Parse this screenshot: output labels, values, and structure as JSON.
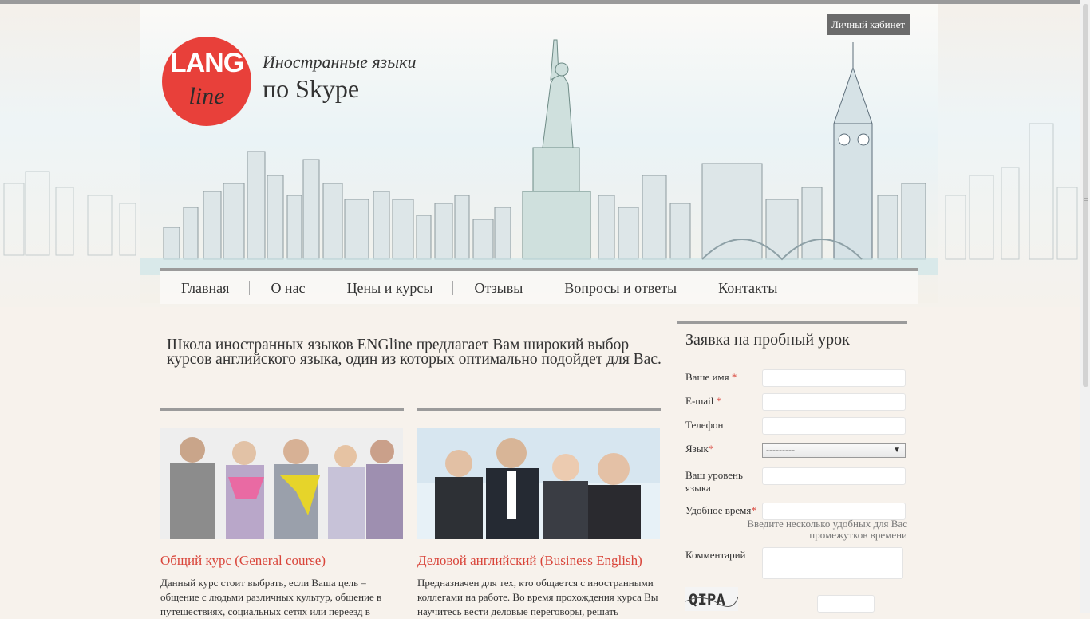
{
  "header": {
    "cabinet_label": "Личный кабинет",
    "logo_top": "LANG",
    "logo_bottom": "line",
    "tagline_1": "Иностранные языки",
    "tagline_2": "по Skype",
    "logo_color": "#e8403a"
  },
  "nav": {
    "items": [
      {
        "label": "Главная"
      },
      {
        "label": "О нас"
      },
      {
        "label": "Цены и курсы"
      },
      {
        "label": "Отзывы"
      },
      {
        "label": "Вопросы и ответы"
      },
      {
        "label": "Контакты"
      }
    ]
  },
  "main": {
    "intro": "Школа иностранных языков ENGline предлагает Вам широкий выбор курсов английского языка, один из которых оптимально подойдет для Вас.",
    "courses": [
      {
        "title": "Общий курс (General course)",
        "desc": "Данный курс стоит выбрать, если Ваша цель – общение с людьми различных культур, общение в путешествиях, социальных сетях или переезд в"
      },
      {
        "title": "Деловой английский (Business English)",
        "desc": "Предназначен для тех, кто общается с иностранными коллегами на работе. Во время прохождения курса Вы научитесь вести деловые переговоры, решать"
      }
    ],
    "link_color": "#d9453a"
  },
  "form": {
    "title": "Заявка на пробный урок",
    "name_label": "Ваше имя",
    "email_label": "E-mail",
    "phone_label": "Телефон",
    "lang_label": "Язык",
    "lang_selected": "---------",
    "level_label": "Ваш уровень языка",
    "time_label": "Удобное время",
    "time_hint": "Введите несколько удобных для Вас промежутков времени",
    "comment_label": "Комментарий",
    "required_mark": "*",
    "captcha_text": "QIPA"
  }
}
